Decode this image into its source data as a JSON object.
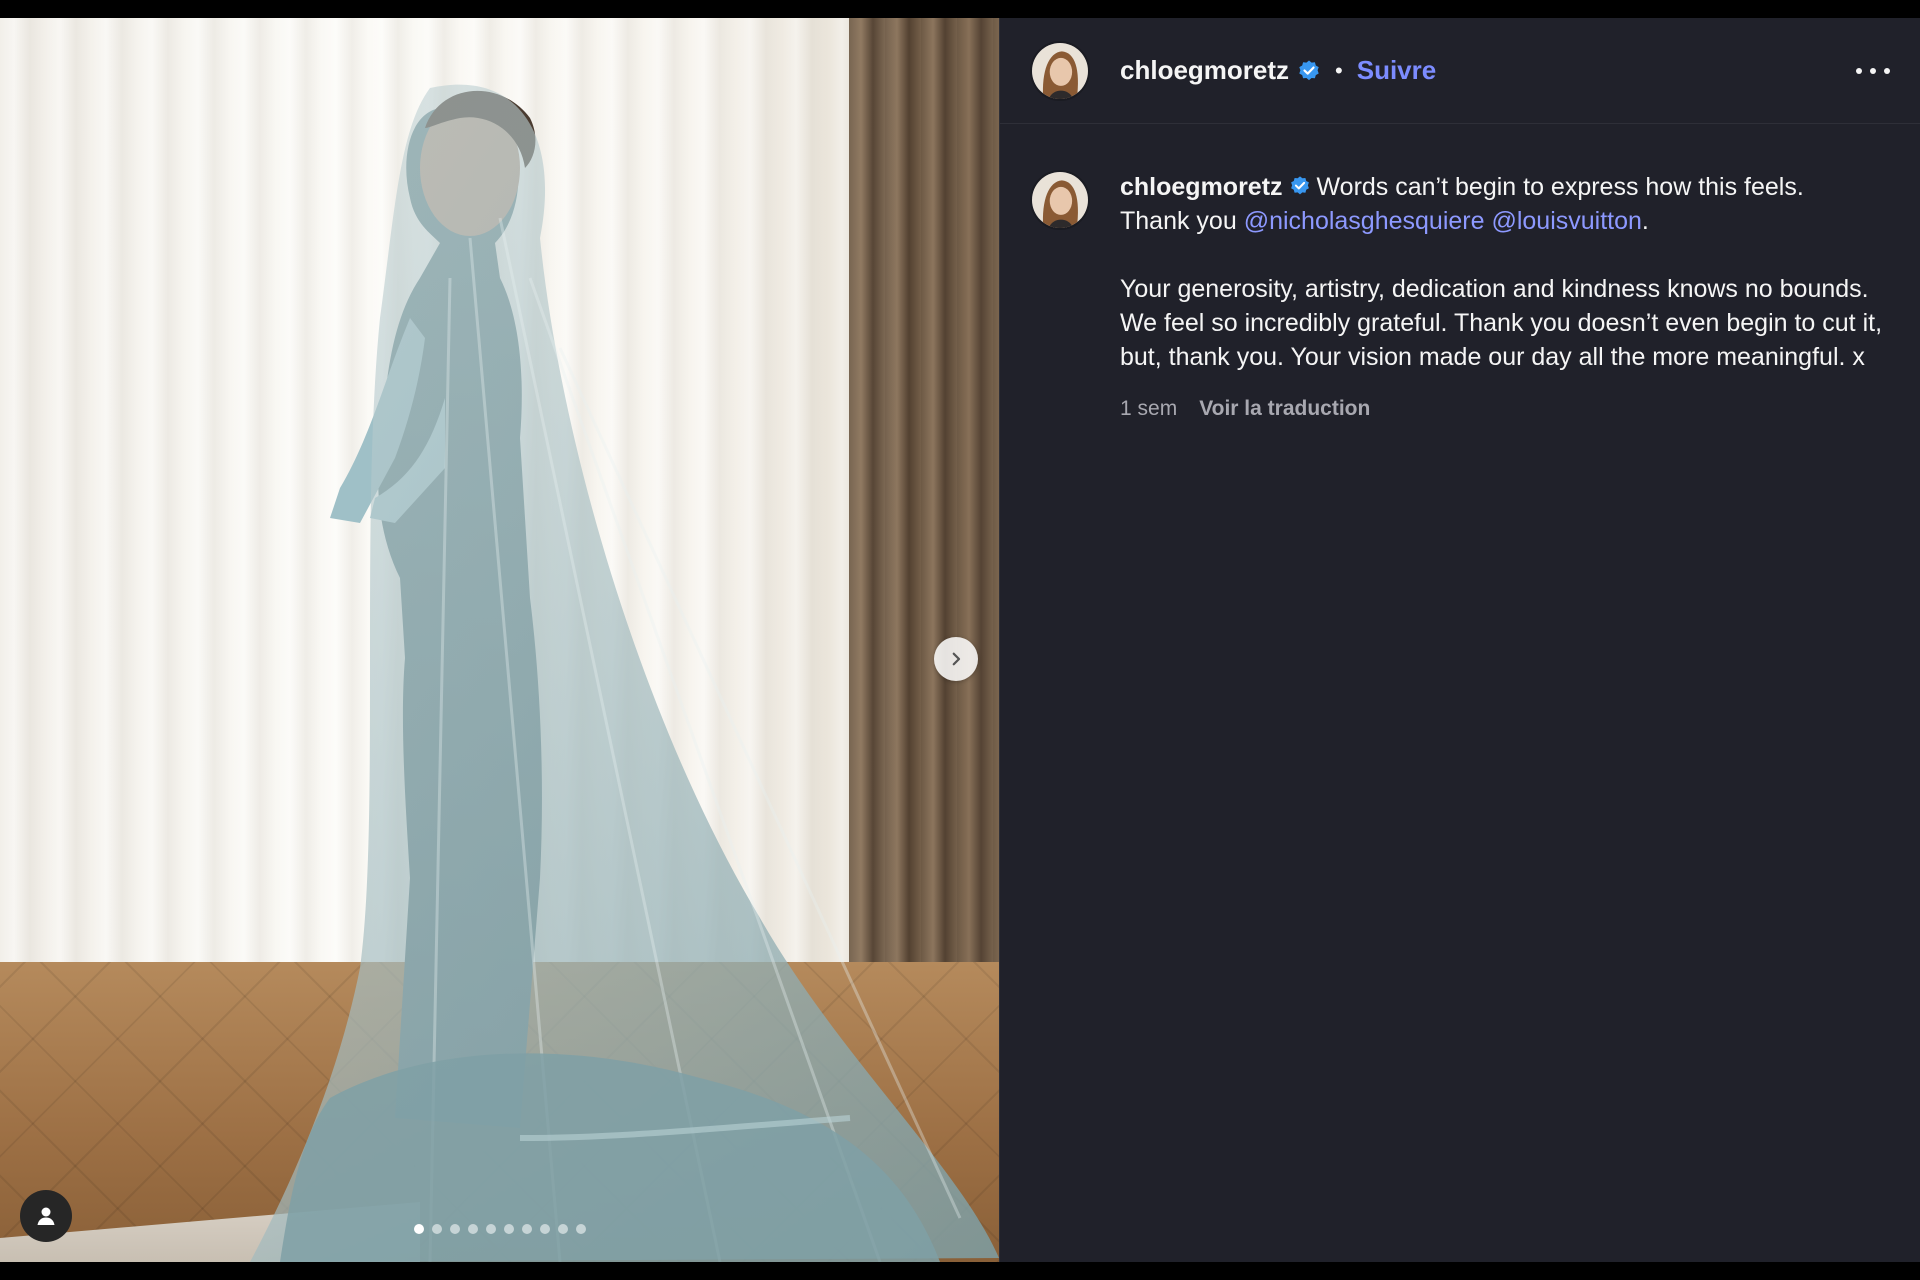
{
  "post": {
    "username": "chloegmoretz",
    "follow_label": "Suivre",
    "separator": "•",
    "more_icon": "more-horizontal-icon",
    "verified_icon": "verified-badge-icon"
  },
  "caption": {
    "username": "chloegmoretz",
    "line1": "Words can’t begin to express how this feels.",
    "thank_you": "Thank you",
    "mention1": "@nicholasghesquiere",
    "mention2": "@louisvuitton",
    "period": ".",
    "paragraph2": "Your generosity, artistry, dedication and kindness knows no bounds. We feel so incredibly grateful. Thank you doesn’t even begin to cut it, but, thank you. Your vision made our day all the more meaningful. x",
    "time": "1 sem",
    "translate_label": "Voir la traduction"
  },
  "carousel": {
    "slide_count": 10,
    "active_index": 0,
    "next_icon": "chevron-right-icon",
    "tag_icon": "user-tag-icon"
  },
  "colors": {
    "panel_bg": "#20212a",
    "link": "#8d99ff",
    "verified": "#3897f0"
  }
}
